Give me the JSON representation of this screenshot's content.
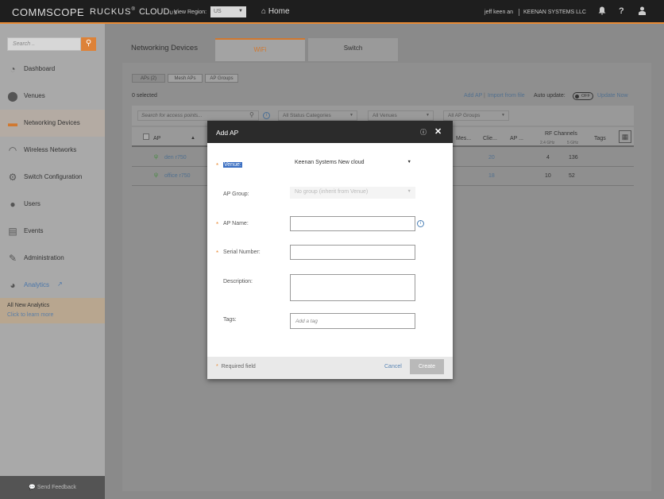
{
  "topbar": {
    "brand": "COMMSCOPE",
    "product": "RUCKUS",
    "product_sub": "CLOUD",
    "product_region": "US",
    "view_region_label": "View Region:",
    "region_value": "US",
    "home_label": "Home",
    "user_name": "jeff keen an",
    "company_name": "KEENAN SYSTEMS LLC",
    "icons": [
      "bell-icon",
      "help-icon",
      "user-icon"
    ]
  },
  "sidebar": {
    "search_placeholder": "Search ..",
    "items": [
      {
        "label": "Dashboard",
        "icon": "dashboard-icon"
      },
      {
        "label": "Venues",
        "icon": "map-pin-icon"
      },
      {
        "label": "Networking Devices",
        "icon": "device-icon",
        "active": true
      },
      {
        "label": "Wireless Networks",
        "icon": "wifi-icon"
      },
      {
        "label": "Switch Configuration",
        "icon": "switch-icon"
      },
      {
        "label": "Users",
        "icon": "user-icon"
      },
      {
        "label": "Events",
        "icon": "events-icon"
      },
      {
        "label": "Administration",
        "icon": "wrench-icon"
      },
      {
        "label": "Analytics",
        "icon": "pie-chart-icon"
      }
    ],
    "analytics_promo_title": "All New Analytics",
    "analytics_promo_link": "Click to learn more",
    "feedback_label": "Send Feedback"
  },
  "main": {
    "page_title": "Networking Devices",
    "tabs": [
      {
        "label": "WiFi",
        "active": true
      },
      {
        "label": "Switch"
      }
    ],
    "subtabs": [
      "APs (2)",
      "Mesh APs",
      "AP Groups"
    ],
    "selected_count": "0 selected",
    "actions": {
      "add_ap": "Add AP",
      "import": "Import from file",
      "auto_update_label": "Auto update:",
      "toggle_state": "OFF",
      "update_now": "Update Now"
    },
    "filters": {
      "search_placeholder": "Search for access points...",
      "status": "All Status Categories",
      "venues": "All Venues",
      "ap_groups": "All AP Groups"
    },
    "columns": {
      "ap": "AP",
      "mesh": "Mes...",
      "clients": "Clie...",
      "ap_col": "AP ...",
      "rf": "RF Channels",
      "rf_24": "2.4 GHz",
      "rf_5": "5 GHz",
      "tags": "Tags"
    },
    "rows": [
      {
        "name": "den r750",
        "clients": "20",
        "ch24": "4",
        "ch5": "136"
      },
      {
        "name": "office r750",
        "clients": "18",
        "ch24": "10",
        "ch5": "52"
      }
    ]
  },
  "modal": {
    "title": "Add AP",
    "venue_label": "Venue:",
    "venue_value": "Keenan Systems New cloud",
    "ap_group_label": "AP Group:",
    "ap_group_value": "No group (inherit from Venue)",
    "ap_name_label": "AP Name:",
    "serial_label": "Serial Number:",
    "description_label": "Description:",
    "tags_label": "Tags:",
    "tags_placeholder": "Add a tag",
    "required_note": "Required field",
    "cancel_label": "Cancel",
    "create_label": "Create"
  }
}
